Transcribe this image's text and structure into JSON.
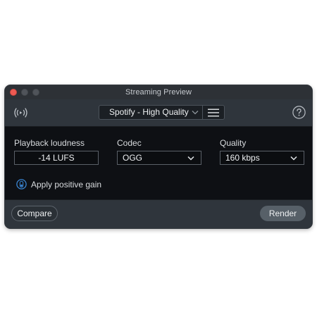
{
  "window": {
    "title": "Streaming Preview"
  },
  "toolbar": {
    "broadcast_icon": "broadcast-icon",
    "preset_value": "Spotify - High Quality",
    "menu_icon": "hamburger-menu-icon",
    "help_icon": "help-icon"
  },
  "fields": {
    "loudness": {
      "label": "Playback loudness",
      "value": "-14  LUFS"
    },
    "codec": {
      "label": "Codec",
      "value": "OGG"
    },
    "quality": {
      "label": "Quality",
      "value": "160 kbps"
    }
  },
  "gain": {
    "label": "Apply positive gain",
    "enabled": false
  },
  "footer": {
    "compare_label": "Compare",
    "render_label": "Render"
  },
  "colors": {
    "accent_toggle": "#3a86d4",
    "window_close": "#ee5a52"
  }
}
